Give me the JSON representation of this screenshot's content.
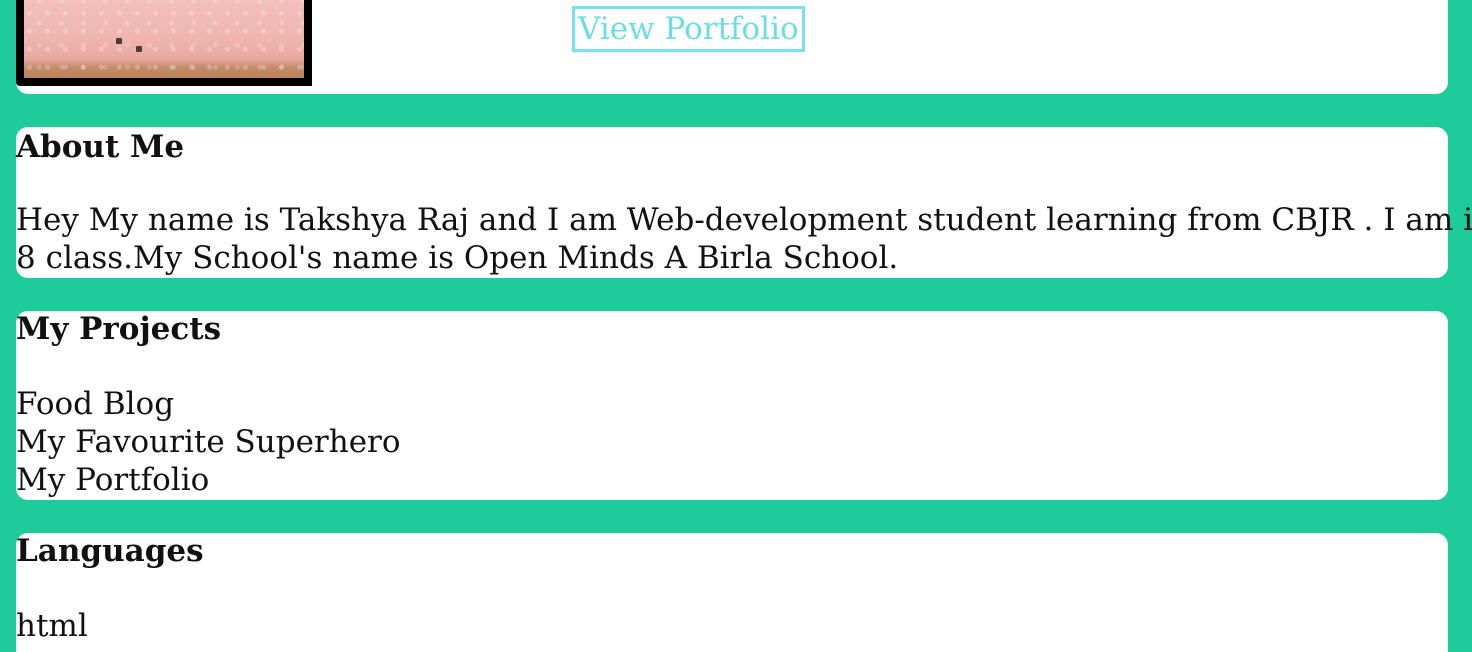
{
  "header": {
    "view_portfolio_label": "View Portfolio"
  },
  "about": {
    "title": "About Me",
    "text_line1": "Hey My name is Takshya Raj and I am Web-development student learning from CBJR . I am in",
    "text_line2": "8 class.My School's name is Open Minds A Birla School."
  },
  "projects": {
    "title": "My Projects",
    "items": [
      "Food Blog",
      "My Favourite Superhero",
      "My Portfolio"
    ]
  },
  "languages": {
    "title": "Languages",
    "items": [
      "html"
    ]
  },
  "colors": {
    "background": "#1ecb9b",
    "card": "#ffffff",
    "link": "#69dde8"
  }
}
